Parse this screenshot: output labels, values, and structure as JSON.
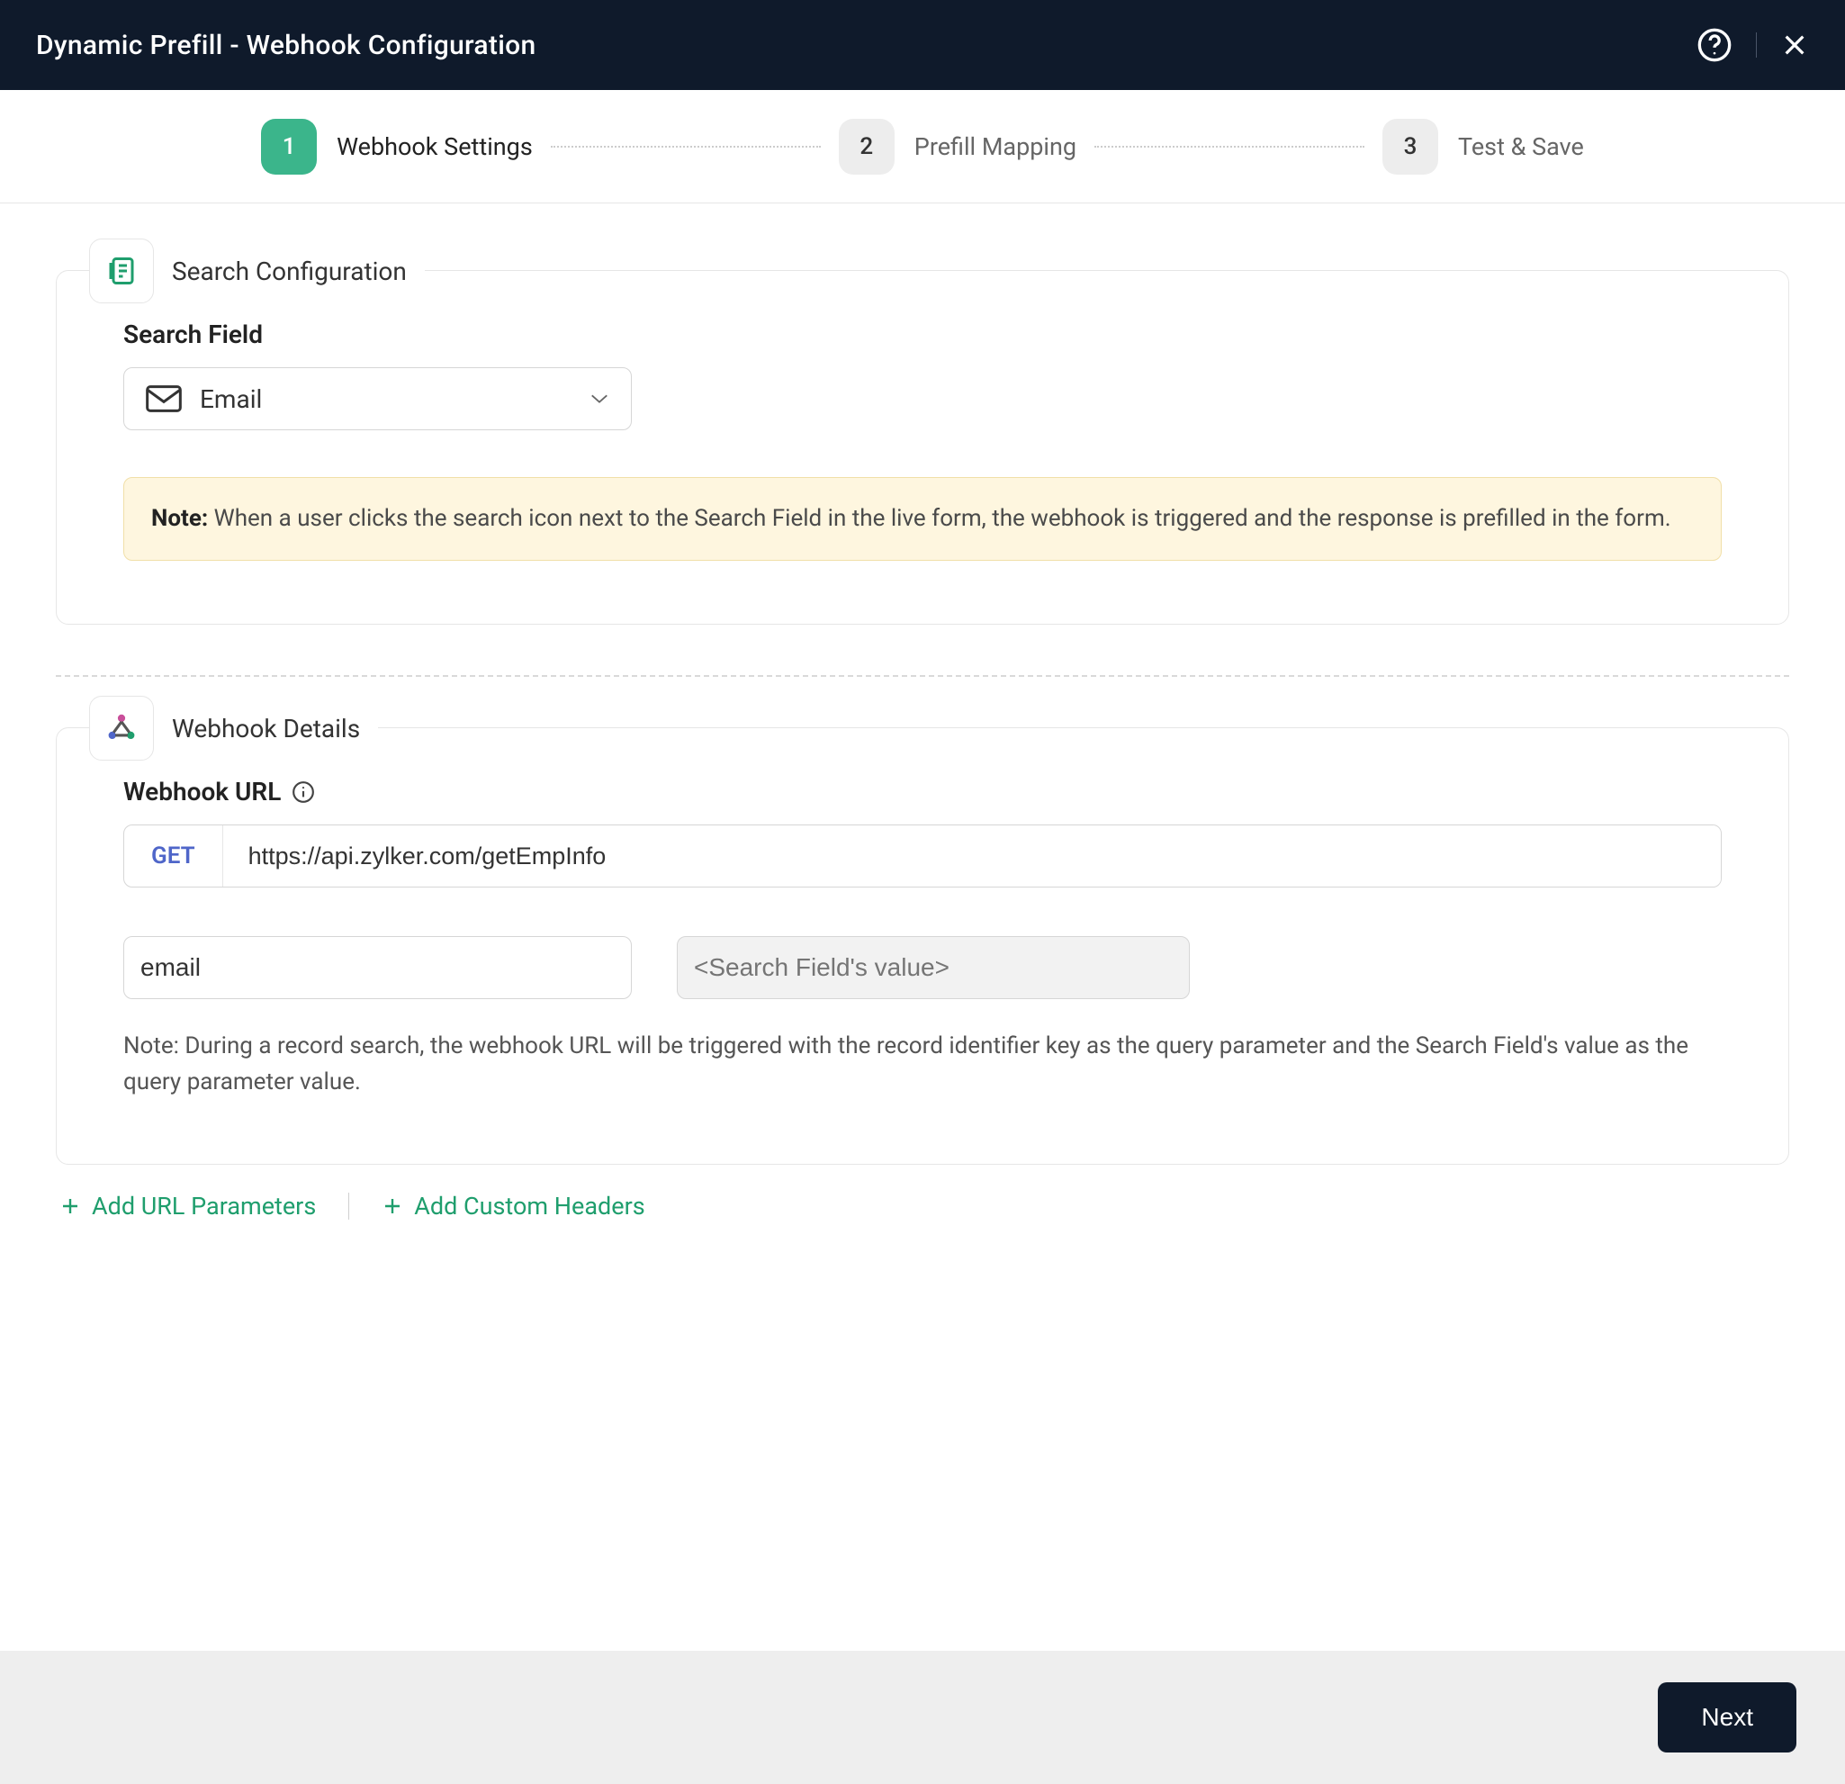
{
  "header": {
    "title": "Dynamic Prefill - Webhook Configuration"
  },
  "stepper": {
    "steps": [
      {
        "num": "1",
        "label": "Webhook Settings",
        "active": true
      },
      {
        "num": "2",
        "label": "Prefill Mapping",
        "active": false
      },
      {
        "num": "3",
        "label": "Test & Save",
        "active": false
      }
    ]
  },
  "searchConfig": {
    "title": "Search Configuration",
    "fieldLabel": "Search Field",
    "selectedField": "Email",
    "noteLabel": "Note:",
    "noteText": " When a user clicks the search icon next to the Search Field in the live form, the webhook is triggered and the response is prefilled in the form."
  },
  "webhookDetails": {
    "title": "Webhook Details",
    "urlLabel": "Webhook URL",
    "method": "GET",
    "url": "https://api.zylker.com/getEmpInfo",
    "paramKey": "email",
    "paramValuePlaceholder": "<Search Field's value>",
    "noteText": "Note: During a record search, the webhook URL will be triggered with the record identifier key as the query parameter and the Search Field's value as the query parameter value."
  },
  "linkActions": {
    "addParams": "Add URL Parameters",
    "addHeaders": "Add Custom Headers"
  },
  "footer": {
    "next": "Next"
  }
}
